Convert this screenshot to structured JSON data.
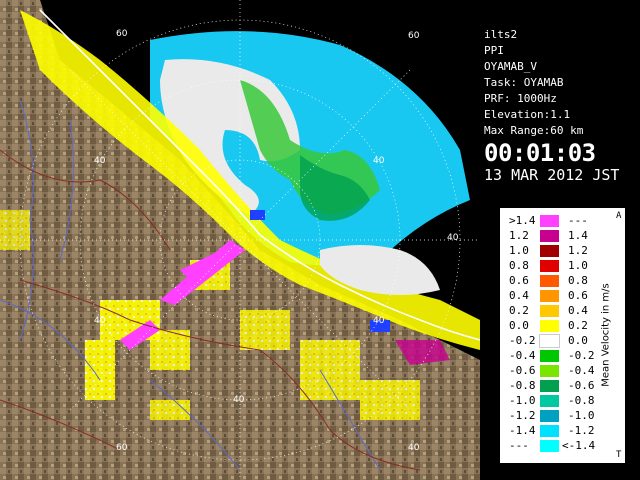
{
  "info": {
    "lines": [
      "ilts2",
      "PPI",
      "OYAMAB_V",
      "Task: OYAMAB",
      "PRF: 1000Hz",
      "Elevation:1.1",
      "Max Range:60 km"
    ],
    "time": "00:01:03",
    "date": "13 MAR 2012 JST"
  },
  "ring_labels": [
    "60",
    "60",
    "40",
    "40",
    "40",
    "40",
    "40",
    "40",
    "60",
    "40"
  ],
  "legend": {
    "title": "Mean Velocity in m/s",
    "corner_top": "A",
    "corner_bottom": "T",
    "rows": [
      {
        "left": ">1.4",
        "right": "---",
        "color": "#ff40ff"
      },
      {
        "left": "1.2",
        "right": "1.4",
        "color": "#c80090"
      },
      {
        "left": "1.0",
        "right": "1.2",
        "color": "#a00000"
      },
      {
        "left": "0.8",
        "right": "1.0",
        "color": "#e00000"
      },
      {
        "left": "0.6",
        "right": "0.8",
        "color": "#ff5a00"
      },
      {
        "left": "0.4",
        "right": "0.6",
        "color": "#ff9600"
      },
      {
        "left": "0.2",
        "right": "0.4",
        "color": "#ffc800"
      },
      {
        "left": "0.0",
        "right": "0.2",
        "color": "#ffff00"
      },
      {
        "left": "-0.2",
        "right": "0.0",
        "color": "#ffffff"
      },
      {
        "left": "-0.4",
        "right": "-0.2",
        "color": "#00c800"
      },
      {
        "left": "-0.6",
        "right": "-0.4",
        "color": "#78e600"
      },
      {
        "left": "-0.8",
        "right": "-0.6",
        "color": "#00a050"
      },
      {
        "left": "-1.0",
        "right": "-0.8",
        "color": "#00c8a0"
      },
      {
        "left": "-1.2",
        "right": "-1.0",
        "color": "#00a0c0"
      },
      {
        "left": "-1.4",
        "right": "-1.2",
        "color": "#00e0ff"
      },
      {
        "left": "---",
        "right": "<-1.4",
        "color": "#00ffff"
      }
    ]
  },
  "colors": {
    "land": "#8a7457",
    "sea_echo_light": "#18c8f0",
    "coast_line": "#ffffff",
    "rivers": "#5a6acb",
    "borders": "#8a2b20"
  }
}
